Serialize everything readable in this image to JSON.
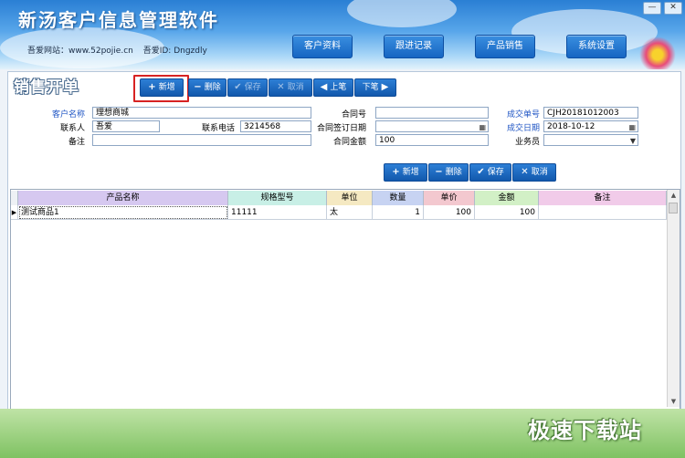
{
  "app": {
    "title": "新汤客户信息管理软件",
    "site_label": "吾爱网站：www.52pojie.cn",
    "id_label": "吾爱ID: Dngzdly",
    "window_controls": [
      "—",
      "✕"
    ]
  },
  "nav": {
    "items": [
      "客户资料",
      "跟进记录",
      "产品销售",
      "系统设置"
    ]
  },
  "page": {
    "title": "销售开单"
  },
  "toolbar": {
    "add": "新增",
    "delete": "删除",
    "save": "保存",
    "cancel": "取消",
    "prev": "上笔",
    "next": "下笔"
  },
  "form": {
    "customer_name_label": "客户名称",
    "customer_name": "理想商城",
    "contact_label": "联系人",
    "contact": "吾爱",
    "phone_label": "联系电话",
    "phone": "3214568",
    "remark_label": "备注",
    "remark": "",
    "contract_no_label": "合同号",
    "contract_no": "",
    "contract_date_label": "合同签订日期",
    "contract_date": "",
    "contract_amount_label": "合同金额",
    "contract_amount": "100",
    "deal_no_label": "成交单号",
    "deal_no": "CJH20181012003",
    "deal_date_label": "成交日期",
    "deal_date": "2018-10-12",
    "salesman_label": "业务员",
    "salesman": ""
  },
  "detail_toolbar": {
    "add": "新增",
    "delete": "删除",
    "save": "保存",
    "cancel": "取消"
  },
  "grid": {
    "columns": [
      "产品名称",
      "规格型号",
      "单位",
      "数量",
      "单价",
      "金额",
      "备注"
    ],
    "rows": [
      [
        "测试商品1",
        "11111",
        "太",
        "1",
        "100",
        "100",
        ""
      ]
    ]
  },
  "watermark": "极速下载站",
  "colors": {
    "accent": "#1665c2",
    "header_product": "#d6c8f0",
    "header_spec": "#c8efe6",
    "header_unit": "#f5e9c2",
    "header_qty": "#c7d3f2",
    "header_price": "#f3c8cf",
    "header_amount": "#d2f0c6",
    "header_remark": "#f1cbe9",
    "highlight": "#d72222"
  }
}
